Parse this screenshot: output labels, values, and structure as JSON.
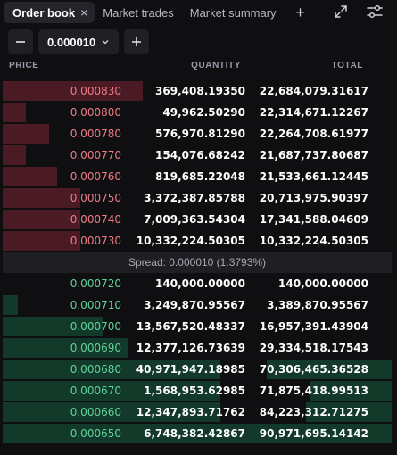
{
  "tabs": [
    {
      "label": "Order book",
      "close": "×"
    },
    {
      "label": "Market trades"
    },
    {
      "label": "Market summary"
    }
  ],
  "tab_add": "+",
  "controls": {
    "minus": "−",
    "tick_size": "0.000010",
    "plus": "+"
  },
  "headers": {
    "price": "PRICE",
    "quantity": "QUANTITY",
    "total": "TOTAL"
  },
  "asks": [
    {
      "price": "0.000830",
      "quantity": "369,408.19350",
      "total": "22,684,079.31617",
      "depth": 0.36
    },
    {
      "price": "0.000800",
      "quantity": "49,962.50290",
      "total": "22,314,671.12267",
      "depth": 0.06
    },
    {
      "price": "0.000780",
      "quantity": "576,970.81290",
      "total": "22,264,708.61977",
      "depth": 0.12
    },
    {
      "price": "0.000770",
      "quantity": "154,076.68242",
      "total": "21,687,737.80687",
      "depth": 0.06
    },
    {
      "price": "0.000760",
      "quantity": "819,685.22048",
      "total": "21,533,661.12445",
      "depth": 0.14
    },
    {
      "price": "0.000750",
      "quantity": "3,372,387.85788",
      "total": "20,713,975.90397",
      "depth": 0.2
    },
    {
      "price": "0.000740",
      "quantity": "7,009,363.54304",
      "total": "17,341,588.04609",
      "depth": 0.2
    },
    {
      "price": "0.000730",
      "quantity": "10,332,224.50305",
      "total": "10,332,224.50305",
      "depth": 0.2
    }
  ],
  "spread": "Spread: 0.000010 (1.3793%)",
  "bids": [
    {
      "price": "0.000720",
      "quantity": "140,000.00000",
      "total": "140,000.00000",
      "depth": 0.0,
      "total_depth": 0.0
    },
    {
      "price": "0.000710",
      "quantity": "3,249,870.95567",
      "total": "3,389,870.95567",
      "depth": 0.04,
      "total_depth": 0.0
    },
    {
      "price": "0.000700",
      "quantity": "13,567,520.48337",
      "total": "16,957,391.43904",
      "depth": 0.26,
      "total_depth": 0.0
    },
    {
      "price": "0.000690",
      "quantity": "12,377,126.73639",
      "total": "29,334,518.17543",
      "depth": 0.32,
      "total_depth": 0.0
    },
    {
      "price": "0.000680",
      "quantity": "40,971,947.18985",
      "total": "70,306,465.36528",
      "depth": 0.56,
      "total_depth": 0.32
    },
    {
      "price": "0.000670",
      "quantity": "1,568,953.62985",
      "total": "71,875,418.99513",
      "depth": 0.56,
      "total_depth": 0.21
    },
    {
      "price": "0.000660",
      "quantity": "12,347,893.71762",
      "total": "84,223,312.71275",
      "depth": 0.56,
      "total_depth": 0.22
    },
    {
      "price": "0.000650",
      "quantity": "6,748,382.42867",
      "total": "90,971,695.14142",
      "depth": 1.0,
      "total_depth": 0.0
    }
  ],
  "colors": {
    "ask": "#f07a86",
    "bid": "#5fd49a",
    "ask_bar": "#4a1b24",
    "bid_bar": "#12392a",
    "background": "#0f0f12"
  },
  "icons": [
    "close-icon",
    "add-tab-icon",
    "expand-icon",
    "settings-sliders-icon",
    "minus-icon",
    "plus-icon",
    "chevron-down-icon"
  ]
}
